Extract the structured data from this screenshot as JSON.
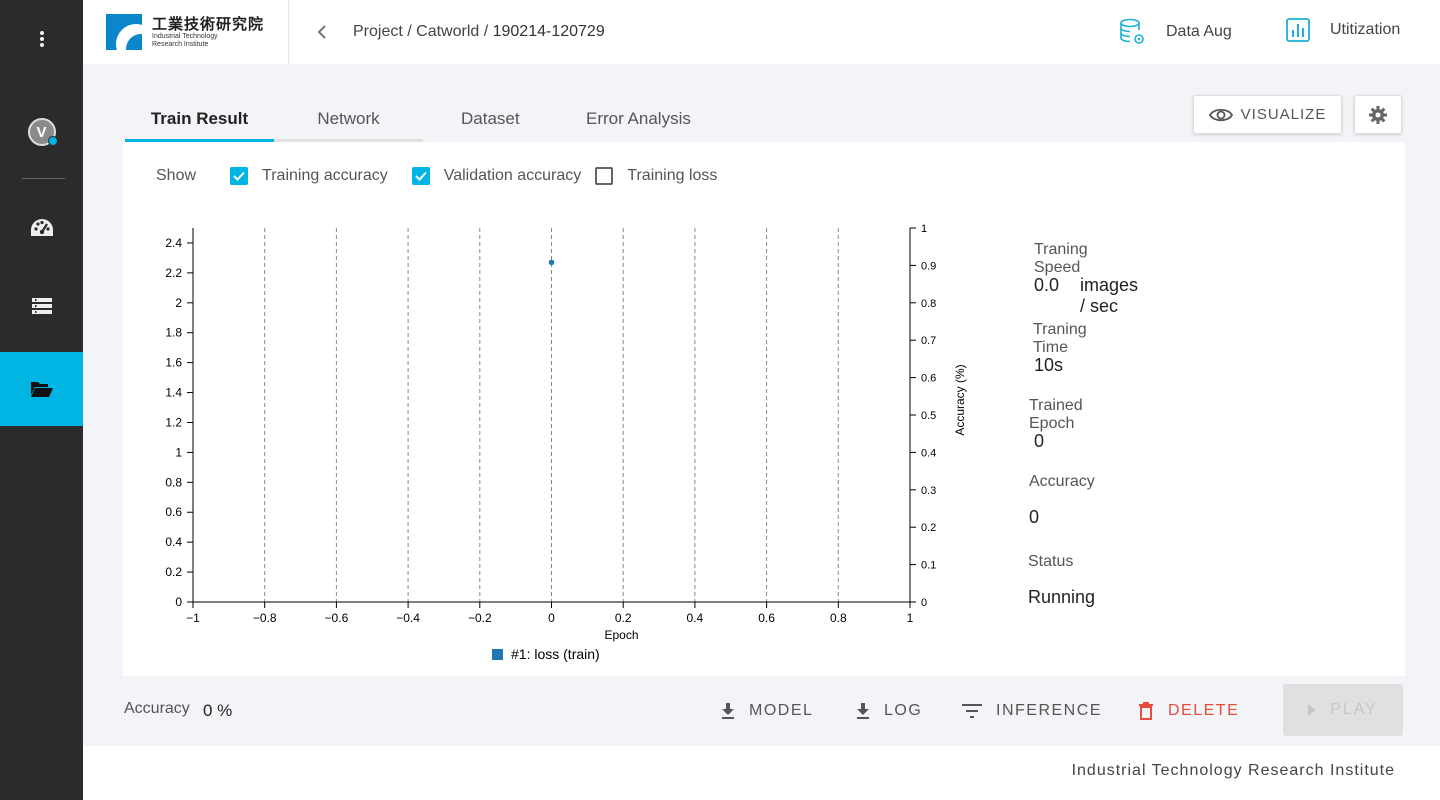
{
  "logo": {
    "cn": "工業技術研究院",
    "en_line1": "Industrial Technology",
    "en_line2": "Research Institute"
  },
  "breadcrumb": {
    "path": "Project / Catworld / ",
    "current": "190214-120729"
  },
  "header_links": {
    "data_aug": "Data Aug",
    "utilization": "Utitization"
  },
  "tabs": [
    "Train Result",
    "Network",
    "Dataset",
    "Error Analysis"
  ],
  "buttons": {
    "visualize": "VISUALIZE",
    "model": "MODEL",
    "log": "LOG",
    "inference": "INFERENCE",
    "delete": "DELETE",
    "play": "PLAY"
  },
  "show": {
    "label": "Show",
    "options": [
      {
        "label": "Training accuracy",
        "checked": true
      },
      {
        "label": "Validation accuracy",
        "checked": true
      },
      {
        "label": "Training loss",
        "checked": false
      }
    ]
  },
  "stats": {
    "speed_label": "Traning Speed",
    "speed_value": "0.0",
    "speed_unit": "images / sec",
    "time_label": "Traning Time",
    "time_value": "10s",
    "epoch_label": "Trained Epoch",
    "epoch_value": "0",
    "accuracy_label": "Accuracy",
    "accuracy_value": "0",
    "status_label": "Status",
    "status_value": "Running"
  },
  "footer": {
    "accuracy_label": "Accuracy",
    "accuracy_value": "0 %",
    "org": "Industrial Technology Research Institute"
  },
  "colors": {
    "accent": "#00b4e4",
    "danger": "#e74c3c",
    "series": "#1f77b4"
  },
  "chart_data": {
    "type": "scatter",
    "xlabel": "Epoch",
    "ylabel_right": "Accuracy (%)",
    "xlim": [
      -1,
      1
    ],
    "ylim_left": [
      0,
      2.5
    ],
    "ylim_right": [
      0,
      1
    ],
    "x_ticks": [
      "−1",
      "−0.8",
      "−0.6",
      "−0.4",
      "−0.2",
      "0",
      "0.2",
      "0.4",
      "0.6",
      "0.8",
      "1"
    ],
    "y_left_ticks": [
      "0",
      "0.2",
      "0.4",
      "0.6",
      "0.8",
      "1",
      "1.2",
      "1.4",
      "1.6",
      "1.8",
      "2",
      "2.2",
      "2.4"
    ],
    "y_right_ticks": [
      "0",
      "0.1",
      "0.2",
      "0.3",
      "0.4",
      "0.5",
      "0.6",
      "0.7",
      "0.8",
      "0.9",
      "1"
    ],
    "series": [
      {
        "name": "#1: loss (train)",
        "points": [
          {
            "x": 0,
            "y": 2.27
          }
        ]
      }
    ],
    "grid": "vertical dashed",
    "legend": "bottom"
  }
}
